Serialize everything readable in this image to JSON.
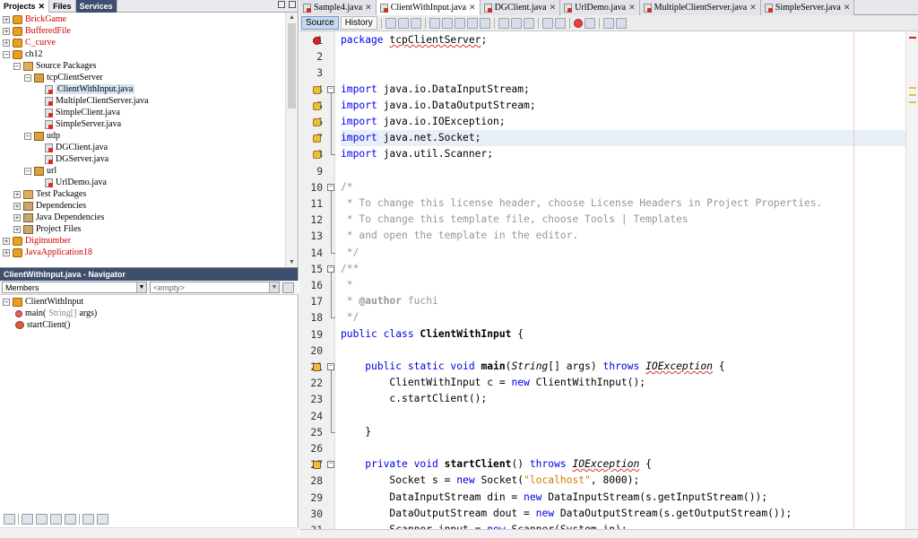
{
  "projects_panel": {
    "tabs": [
      {
        "label": "Projects",
        "close": "✕"
      },
      {
        "label": "Files"
      },
      {
        "label": "Services"
      }
    ],
    "tree": [
      {
        "label": "BrickGame",
        "level": 0,
        "kind": "proj",
        "expander": "+",
        "red": true
      },
      {
        "label": "BufferedFile",
        "level": 0,
        "kind": "proj",
        "expander": "+",
        "red": true
      },
      {
        "label": "C_curve",
        "level": 0,
        "kind": "proj",
        "expander": "+",
        "red": true
      },
      {
        "label": "ch12",
        "level": 0,
        "kind": "proj",
        "expander": "−",
        "red": false
      },
      {
        "label": "Source Packages",
        "level": 1,
        "kind": "src",
        "expander": "−"
      },
      {
        "label": "tcpClientServer",
        "level": 2,
        "kind": "pkg",
        "expander": "−"
      },
      {
        "label": "ClientWithInput.java",
        "level": 3,
        "kind": "java",
        "expander": ""
      },
      {
        "label": "MultipleClientServer.java",
        "level": 3,
        "kind": "java",
        "expander": ""
      },
      {
        "label": "SimpleClient.java",
        "level": 3,
        "kind": "java",
        "expander": ""
      },
      {
        "label": "SimpleServer.java",
        "level": 3,
        "kind": "java",
        "expander": ""
      },
      {
        "label": "udp",
        "level": 2,
        "kind": "pkg",
        "expander": "−"
      },
      {
        "label": "DGClient.java",
        "level": 3,
        "kind": "java",
        "expander": ""
      },
      {
        "label": "DGServer.java",
        "level": 3,
        "kind": "java",
        "expander": ""
      },
      {
        "label": "url",
        "level": 2,
        "kind": "pkg",
        "expander": "−"
      },
      {
        "label": "UrlDemo.java",
        "level": 3,
        "kind": "java",
        "expander": ""
      },
      {
        "label": "Test Packages",
        "level": 1,
        "kind": "src",
        "expander": "+"
      },
      {
        "label": "Dependencies",
        "level": 1,
        "kind": "lib",
        "expander": "+"
      },
      {
        "label": "Java Dependencies",
        "level": 1,
        "kind": "lib",
        "expander": "+"
      },
      {
        "label": "Project Files",
        "level": 1,
        "kind": "lib",
        "expander": "+"
      },
      {
        "label": "Digitnumber",
        "level": 0,
        "kind": "proj",
        "expander": "+",
        "red": true
      },
      {
        "label": "JavaApplication18",
        "level": 0,
        "kind": "proj",
        "expander": "+",
        "red": true
      }
    ]
  },
  "navigator": {
    "title": "ClientWithInput.java - Navigator",
    "filter_label": "Members",
    "scope_label": "<empty>",
    "items": [
      {
        "label": "ClientWithInput",
        "level": 0,
        "kind": "cls"
      },
      {
        "label": "main(",
        "type": "String[]",
        "rest": " args)",
        "level": 1,
        "kind": "meth"
      },
      {
        "label": "startClient()",
        "type": "",
        "rest": "",
        "level": 1,
        "kind": "meth2"
      }
    ]
  },
  "editor": {
    "tabs": [
      {
        "label": "Sample4.java",
        "active": false
      },
      {
        "label": "ClientWithInput.java",
        "active": true
      },
      {
        "label": "DGClient.java",
        "active": false
      },
      {
        "label": "UrlDemo.java",
        "active": false
      },
      {
        "label": "MultipleClientServer.java",
        "active": false
      },
      {
        "label": "SimpleServer.java",
        "active": false
      }
    ],
    "close_glyph": "✕",
    "toolbar": {
      "source": "Source",
      "history": "History"
    },
    "lines": [
      {
        "n": "1",
        "segs": [
          [
            "kw",
            "package "
          ],
          [
            "und",
            "tcpClientServer"
          ],
          [
            "",
            "; "
          ]
        ]
      },
      {
        "n": "2",
        "segs": []
      },
      {
        "n": "3",
        "segs": []
      },
      {
        "n": "4",
        "segs": [
          [
            "kw",
            "import "
          ],
          [
            "",
            "java.io.DataInputStream;"
          ]
        ]
      },
      {
        "n": "5",
        "segs": [
          [
            "kw",
            "import "
          ],
          [
            "",
            "java.io.DataOutputStream;"
          ]
        ]
      },
      {
        "n": "6",
        "segs": [
          [
            "kw",
            "import "
          ],
          [
            "",
            "java.io.IOException;"
          ]
        ]
      },
      {
        "n": "7",
        "segs": [
          [
            "kw",
            "import "
          ],
          [
            "",
            "java.net.Socket;"
          ]
        ]
      },
      {
        "n": "8",
        "segs": [
          [
            "kw",
            "import "
          ],
          [
            "",
            "java.util.Scanner;"
          ]
        ]
      },
      {
        "n": "9",
        "segs": []
      },
      {
        "n": "10",
        "segs": [
          [
            "cm",
            "/*"
          ]
        ]
      },
      {
        "n": "11",
        "segs": [
          [
            "cm",
            " * To change this license header, choose License Headers in Project Properties."
          ]
        ]
      },
      {
        "n": "12",
        "segs": [
          [
            "cm",
            " * To change this template file, choose Tools | Templates"
          ]
        ]
      },
      {
        "n": "13",
        "segs": [
          [
            "cm",
            " * and open the template in the editor."
          ]
        ]
      },
      {
        "n": "14",
        "segs": [
          [
            "cm",
            " */"
          ]
        ]
      },
      {
        "n": "15",
        "segs": [
          [
            "cm",
            "/**"
          ]
        ]
      },
      {
        "n": "16",
        "segs": [
          [
            "cm",
            " *"
          ]
        ]
      },
      {
        "n": "17",
        "segs": [
          [
            "cm",
            " * "
          ],
          [
            "ann",
            "@author"
          ],
          [
            "cm",
            " fuchi"
          ]
        ]
      },
      {
        "n": "18",
        "segs": [
          [
            "cm",
            " */"
          ]
        ]
      },
      {
        "n": "19",
        "segs": [
          [
            "kw",
            "public class "
          ],
          [
            "bold",
            "ClientWithInput"
          ],
          [
            "",
            " {"
          ]
        ]
      },
      {
        "n": "20",
        "segs": []
      },
      {
        "n": "21",
        "segs": [
          [
            "",
            "    "
          ],
          [
            "kw",
            "public static void "
          ],
          [
            "bold",
            "main"
          ],
          [
            "",
            "("
          ],
          [
            "ital",
            "String"
          ],
          [
            "",
            "[] args) "
          ],
          [
            "kw",
            "throws "
          ],
          [
            "ital und",
            "IOException"
          ],
          [
            "",
            " {"
          ]
        ]
      },
      {
        "n": "22",
        "segs": [
          [
            "",
            "        ClientWithInput c = "
          ],
          [
            "kw",
            "new "
          ],
          [
            "",
            "ClientWithInput();"
          ]
        ]
      },
      {
        "n": "23",
        "segs": [
          [
            "",
            "        c.startClient();"
          ]
        ]
      },
      {
        "n": "24",
        "segs": []
      },
      {
        "n": "25",
        "segs": [
          [
            "",
            "    }"
          ]
        ]
      },
      {
        "n": "26",
        "segs": []
      },
      {
        "n": "27",
        "segs": [
          [
            "",
            "    "
          ],
          [
            "kw",
            "private void "
          ],
          [
            "bold",
            "startClient"
          ],
          [
            "",
            "() "
          ],
          [
            "kw",
            "throws "
          ],
          [
            "ital und",
            "IOException"
          ],
          [
            "",
            " {"
          ]
        ]
      },
      {
        "n": "28",
        "segs": [
          [
            "",
            "        Socket s = "
          ],
          [
            "kw",
            "new "
          ],
          [
            "",
            "Socket("
          ],
          [
            "str",
            "\"localhost\""
          ],
          [
            "",
            ", 8000);"
          ]
        ]
      },
      {
        "n": "29",
        "segs": [
          [
            "",
            "        DataInputStream din = "
          ],
          [
            "kw",
            "new "
          ],
          [
            "",
            "DataInputStream(s.getInputStream());"
          ]
        ]
      },
      {
        "n": "30",
        "segs": [
          [
            "",
            "        DataOutputStream dout = "
          ],
          [
            "kw",
            "new "
          ],
          [
            "",
            "DataOutputStream(s.getOutputStream());"
          ]
        ]
      },
      {
        "n": "31",
        "segs": [
          [
            "",
            "        Scanner input = "
          ],
          [
            "kw",
            "new "
          ],
          [
            "",
            "Scanner(System.in);"
          ]
        ]
      }
    ]
  },
  "colors": {
    "keyword": "#0000e6",
    "comment": "#969696",
    "string": "#ce7b00",
    "error": "#d82020",
    "highlight_line": "#e9eff8"
  }
}
